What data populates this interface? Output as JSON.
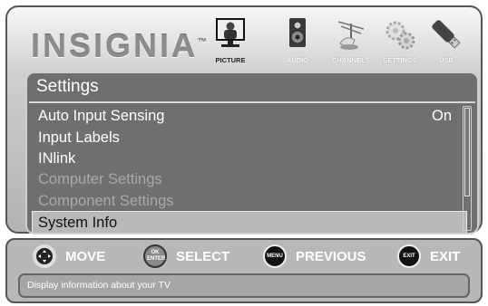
{
  "brand": {
    "logo": "INSIGNIA",
    "tm": "™"
  },
  "tabs": [
    {
      "label": "PICTURE",
      "icon": "picture-icon",
      "active": true
    },
    {
      "label": "AUDIO",
      "icon": "speaker-icon",
      "active": false
    },
    {
      "label": "CHANNELS",
      "icon": "antenna-icon",
      "active": false
    },
    {
      "label": "SETTINGS",
      "icon": "gears-icon",
      "active": false
    },
    {
      "label": "USB",
      "icon": "usb-icon",
      "active": false
    }
  ],
  "menu": {
    "title": "Settings",
    "items": [
      {
        "label": "Auto Input Sensing",
        "value": "On",
        "state": "normal"
      },
      {
        "label": "Input Labels",
        "value": "",
        "state": "normal"
      },
      {
        "label": "INlink",
        "value": "",
        "state": "normal"
      },
      {
        "label": "Computer Settings",
        "value": "",
        "state": "disabled"
      },
      {
        "label": "Component Settings",
        "value": "",
        "state": "disabled"
      },
      {
        "label": "System Info",
        "value": "",
        "state": "selected"
      }
    ]
  },
  "hints": [
    {
      "button": "move-dpad-icon",
      "button_text": "",
      "label": "MOVE"
    },
    {
      "button": "ok-enter-button-icon",
      "button_text": "OK ENTER",
      "label": "SELECT"
    },
    {
      "button": "menu-button-icon",
      "button_text": "MENU",
      "label": "PREVIOUS"
    },
    {
      "button": "exit-button-icon",
      "button_text": "EXIT",
      "label": "EXIT"
    }
  ],
  "description": "Display information about your TV"
}
